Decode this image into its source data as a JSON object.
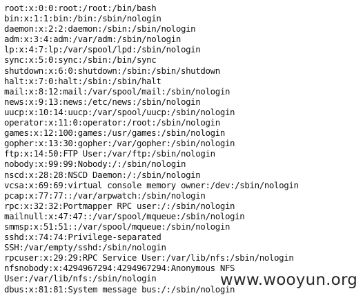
{
  "lines": [
    "root:x:0:0:root:/root:/bin/bash",
    "bin:x:1:1:bin:/bin:/sbin/nologin",
    "daemon:x:2:2:daemon:/sbin:/sbin/nologin",
    "adm:x:3:4:adm:/var/adm:/sbin/nologin",
    "lp:x:4:7:lp:/var/spool/lpd:/sbin/nologin",
    "sync:x:5:0:sync:/sbin:/bin/sync",
    "shutdown:x:6:0:shutdown:/sbin:/sbin/shutdown",
    "halt:x:7:0:halt:/sbin:/sbin/halt",
    "mail:x:8:12:mail:/var/spool/mail:/sbin/nologin",
    "news:x:9:13:news:/etc/news:/sbin/nologin",
    "uucp:x:10:14:uucp:/var/spool/uucp:/sbin/nologin",
    "operator:x:11:0:operator:/root:/sbin/nologin",
    "games:x:12:100:games:/usr/games:/sbin/nologin",
    "gopher:x:13:30:gopher:/var/gopher:/sbin/nologin",
    "ftp:x:14:50:FTP User:/var/ftp:/sbin/nologin",
    "nobody:x:99:99:Nobody:/:/sbin/nologin",
    "nscd:x:28:28:NSCD Daemon:/:/sbin/nologin",
    "vcsa:x:69:69:virtual console memory owner:/dev:/sbin/nologin",
    "pcap:x:77:77::/var/arpwatch:/sbin/nologin",
    "rpc:x:32:32:Portmapper RPC user:/:/sbin/nologin",
    "mailnull:x:47:47::/var/spool/mqueue:/sbin/nologin",
    "smmsp:x:51:51::/var/spool/mqueue:/sbin/nologin",
    "sshd:x:74:74:Privilege-separated",
    "SSH:/var/empty/sshd:/sbin/nologin",
    "rpcuser:x:29:29:RPC Service User:/var/lib/nfs:/sbin/nologin",
    "nfsnobody:x:4294967294:4294967294:Anonymous NFS",
    "User:/var/lib/nfs:/sbin/nologin",
    "dbus:x:81:81:System message bus:/:/sbin/nologin"
  ],
  "watermark": "www.wooyun.org"
}
